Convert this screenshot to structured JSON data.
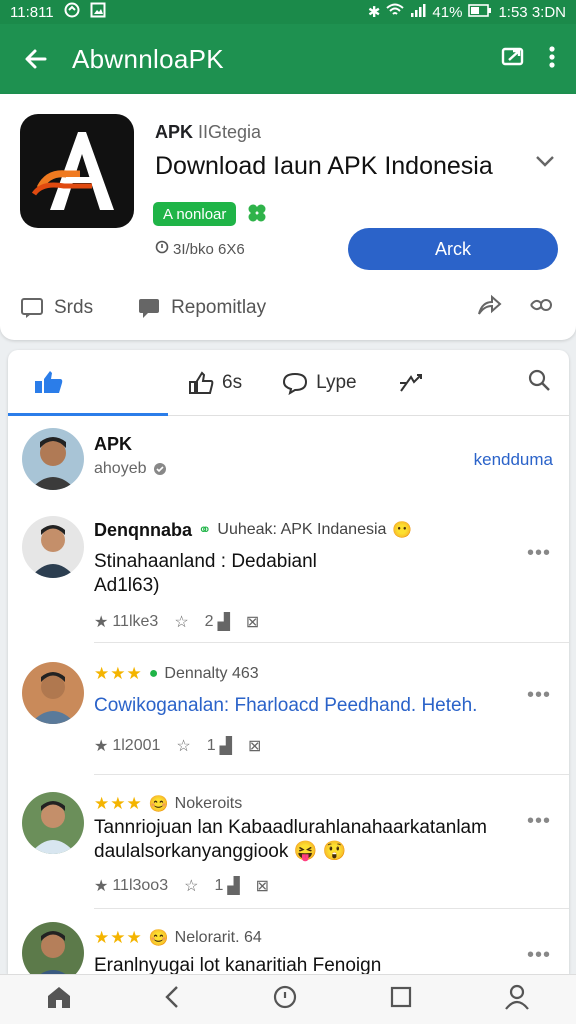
{
  "status": {
    "time": "11:811",
    "battery": "41%",
    "clock": "1:53 3:DN"
  },
  "appbar": {
    "title": "AbwnnloaPK"
  },
  "app": {
    "publisher_label": "APK",
    "publisher_rest": "IIGtegia",
    "name": "Download Iaun APK Indonesia",
    "badge": "A nonloar",
    "meta": "3I/bko 6X6",
    "install_label": "Arck",
    "action1": "Srds",
    "action2": "Repomitlay"
  },
  "tabs": {
    "tab2": "6s",
    "tab3": "Lype"
  },
  "posts": [
    {
      "name": "APK",
      "sub": "ahoyeb",
      "link": "kendduma"
    },
    {
      "name": "Denqnnaba",
      "tag": "Uuheak: APK Indanesia",
      "body1": "Stinahaanland : Dedabianl",
      "body2": "Ad1l63)",
      "s1": "11lke3",
      "s2": "2"
    },
    {
      "rating": "Dennalty 463",
      "body": "Cowikoganalan: Fharloacd Peedhand. Heteh.",
      "s1": "1l2001",
      "s2": "1"
    },
    {
      "rating": "Nokeroits",
      "body1": "Tannriojuan lan Kabaadlurahlanahaarkatanlam",
      "body2": "daulalsorkanyanggiook",
      "s1": "11l3oo3",
      "s2": "1"
    },
    {
      "rating": "Nelorarit. 64",
      "body": "Eranlnyugai lot kanaritiah Fenoign"
    }
  ]
}
